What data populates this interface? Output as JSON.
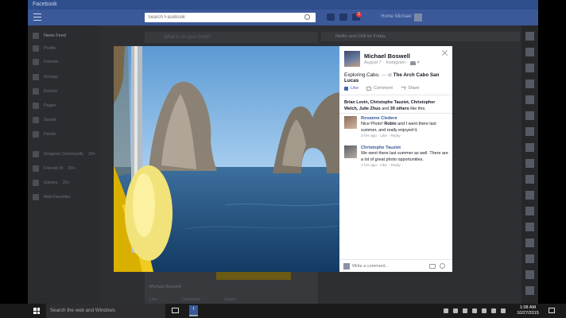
{
  "window": {
    "title": "Facebook"
  },
  "fbbar": {
    "search_placeholder": "Search Facebook",
    "badge_count": "1",
    "home_label": "Home",
    "user_label": "Michael"
  },
  "sidebar": {
    "items": [
      {
        "label": "News Feed",
        "icon": "news-feed-icon"
      },
      {
        "label": "Profile",
        "icon": "profile-icon"
      },
      {
        "label": "Friends",
        "icon": "friends-icon"
      },
      {
        "label": "Groups",
        "icon": "groups-icon"
      },
      {
        "label": "Events",
        "icon": "events-icon"
      },
      {
        "label": "Pages",
        "icon": "pages-icon"
      },
      {
        "label": "Saved",
        "icon": "saved-icon"
      },
      {
        "label": "Feeds",
        "icon": "feeds-icon"
      }
    ],
    "groups": [
      {
        "label": "Dragons Community",
        "count": "20+"
      },
      {
        "label": "Friends III",
        "count": "20+"
      },
      {
        "label": "Games",
        "count": "20+"
      }
    ],
    "add_favorites": "Add Favorites"
  },
  "feed": {
    "composer_placeholder": "What is on your mind?",
    "trending_label": "Netflix and Chill for Friday",
    "strip_text": "Michael Boswell",
    "strip_actions": [
      "Like",
      "Comment",
      "Share"
    ]
  },
  "post": {
    "author": "Michael Boswell",
    "date": "August 7",
    "via": "Instagram",
    "caption_prefix": "Exploring Cabo.",
    "caption_at": "— at",
    "location": "The Arch Cabo San Lucas",
    "actions": {
      "like": "Like",
      "comment": "Comment",
      "share": "Share"
    },
    "likers_names": "Brian Lovin, Christophe Tauziet, Christopher Welch, Julie Zhuo",
    "likers_and": "and",
    "likers_others": "39 others",
    "likers_suffix": "like this."
  },
  "comments": [
    {
      "name": "Roxanne Cledere",
      "text_before": "Nice Photo!",
      "mention": "Robin",
      "text_after": "and I went there last summer, and really enjoyed it.",
      "meta": "3 hrs ago · Like · Reply"
    },
    {
      "name": "Christophe Tauziet",
      "text_before": "We went there last summer as well. There are a lot of great photo opportunities.",
      "mention": "",
      "text_after": "",
      "meta": "2 hrs ago · Like · Reply"
    }
  ],
  "composer": {
    "placeholder": "Write a comment..."
  },
  "taskbar": {
    "search_text": "Search the web and Windows",
    "fb_app_label": "f",
    "time": "1:08 AM",
    "date": "10/27/2015"
  },
  "colors": {
    "facebook_blue": "#3b5998",
    "link_blue": "#365899",
    "like_blue": "#4267b2"
  }
}
